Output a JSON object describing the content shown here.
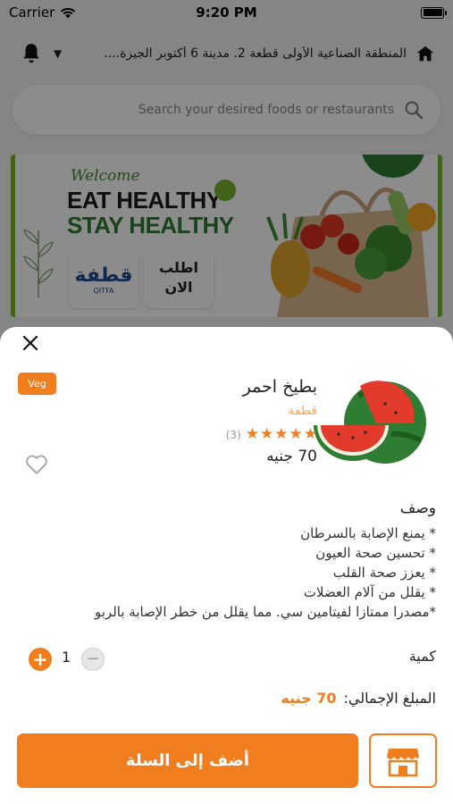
{
  "status_bar": {
    "carrier": "Carrier",
    "time": "9:20 PM"
  },
  "header": {
    "address": "المنطقة الصناعية الأولى قطعة 2. مدينة 6 أكتوبر الجيزة...."
  },
  "search": {
    "placeholder": "Search your desired foods or restaurants"
  },
  "banner": {
    "welcome": "Welcome",
    "line1": "EAT HEALTHY",
    "line2": "STAY HEALTHY",
    "logo_ar": "قطفة",
    "logo_en": "QITFA",
    "order_now": "اطلب\nالان"
  },
  "product": {
    "badge": "Veg",
    "name": "بطيخ احمر",
    "store": "قطفة",
    "rating_stars": 5,
    "rating_count": "(3)",
    "price": "70 جنيه",
    "description_title": "وصف",
    "description": [
      "* يمنع الإصابة بالسرطان",
      "* تحسين صحة العيون",
      "* يعزز صحة القلب",
      "* يقلل من آلام العضلات",
      "*مصدرا ممتازا لفيتامين سي. مما يقلل من خطر الإصابة بالربو"
    ],
    "quantity_label": "كمية",
    "quantity": "1",
    "total_label": "المبلغ الإجمالي:",
    "total_value": "70 جنيه",
    "add_to_cart": "أضف إلى السلة"
  },
  "colors": {
    "accent": "#f07e1f",
    "banner_green": "#7ab52e"
  }
}
